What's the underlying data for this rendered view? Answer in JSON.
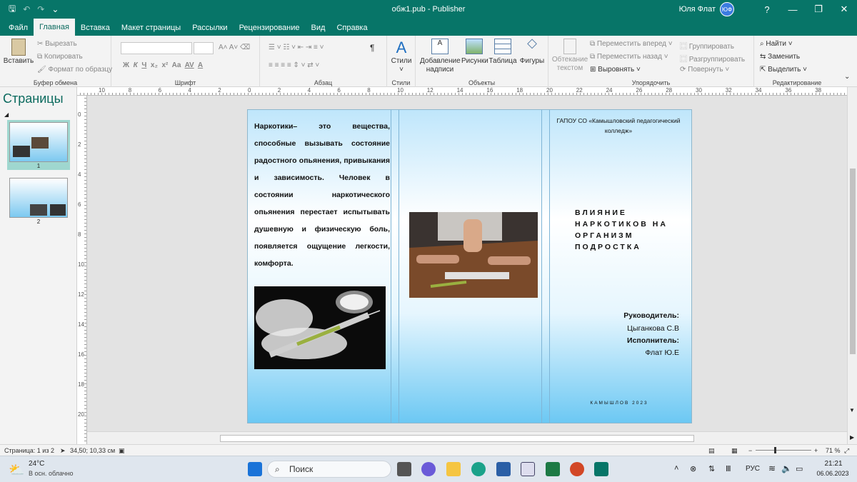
{
  "titlebar": {
    "doc_title": "обж1.pub  -  Publisher",
    "user_name": "Юля Флат",
    "user_initials": "ЮФ",
    "help": "?"
  },
  "tabs": [
    "Файл",
    "Главная",
    "Вставка",
    "Макет страницы",
    "Рассылки",
    "Рецензирование",
    "Вид",
    "Справка"
  ],
  "active_tab": "Главная",
  "ribbon": {
    "clipboard": {
      "label": "Буфер обмена",
      "paste": "Вставить",
      "cut": "Вырезать",
      "copy": "Копировать",
      "format_painter": "Формат по образцу"
    },
    "font": {
      "label": "Шрифт",
      "bold": "Ж",
      "italic": "К",
      "underline": "Ч",
      "subscript": "x₂",
      "superscript": "x²",
      "case": "Aa",
      "spacing": "AV",
      "color": "A"
    },
    "paragraph": {
      "label": "Абзац",
      "pilcrow": "¶"
    },
    "styles": {
      "label": "Стили",
      "button": "Стили"
    },
    "objects": {
      "label": "Объекты",
      "text_box": "Добавление надписи",
      "pictures": "Рисунки",
      "table": "Таблица",
      "shapes": "Фигуры"
    },
    "arrange": {
      "label": "Упорядочить",
      "wrap_text": "Обтекание текстом",
      "bring_forward": "Переместить вперед",
      "send_backward": "Переместить назад",
      "align": "Выровнять",
      "group": "Группировать",
      "ungroup": "Разгруппировать",
      "rotate": "Повернуть"
    },
    "editing": {
      "label": "Редактирование",
      "find": "Найти",
      "replace": "Заменить",
      "select": "Выделить"
    }
  },
  "pages_pane": {
    "title": "Страницы",
    "pages": [
      "1",
      "2"
    ]
  },
  "ruler": {
    "h_numbers": [
      "10",
      "8",
      "6",
      "4",
      "2",
      "0",
      "2",
      "4",
      "6",
      "8",
      "10",
      "12",
      "14",
      "16",
      "18",
      "20",
      "22",
      "24",
      "26",
      "28",
      "30",
      "32",
      "34",
      "36",
      "38"
    ],
    "v_numbers": [
      "0",
      "2",
      "4",
      "6",
      "8",
      "10",
      "12",
      "14",
      "16",
      "18",
      "20"
    ]
  },
  "document": {
    "panel1_text": "Наркотики– это вещества, способные вызывать состояние радостного опьянения, привыкания и зависимость. Человек в состоянии наркотического опьянения перестает испытывать душевную и физическую боль, появляется ощущение легкости, комфорта.",
    "institution": "ГАПОУ СО «Камышловский педагогический колледж»",
    "title": "ВЛИЯНИЕ НАРКОТИКОВ НА ОРГАНИЗМ ПОДРОСТКА",
    "supervisor_label": "Руководитель:",
    "supervisor_name": "Цыганкова С.В",
    "author_label": "Исполнитель:",
    "author_name": "Флат Ю.Е",
    "city_year": "КАМЫШЛОВ 2023"
  },
  "status": {
    "page": "Страница: 1 из 2",
    "coords": "34,50; 10,33 см",
    "zoom": "71 %"
  },
  "taskbar": {
    "temp": "24°C",
    "weather": "В осн. облачно",
    "search": "Поиск",
    "lang": "РУС",
    "time": "21:21",
    "date": "06.06.2023"
  }
}
